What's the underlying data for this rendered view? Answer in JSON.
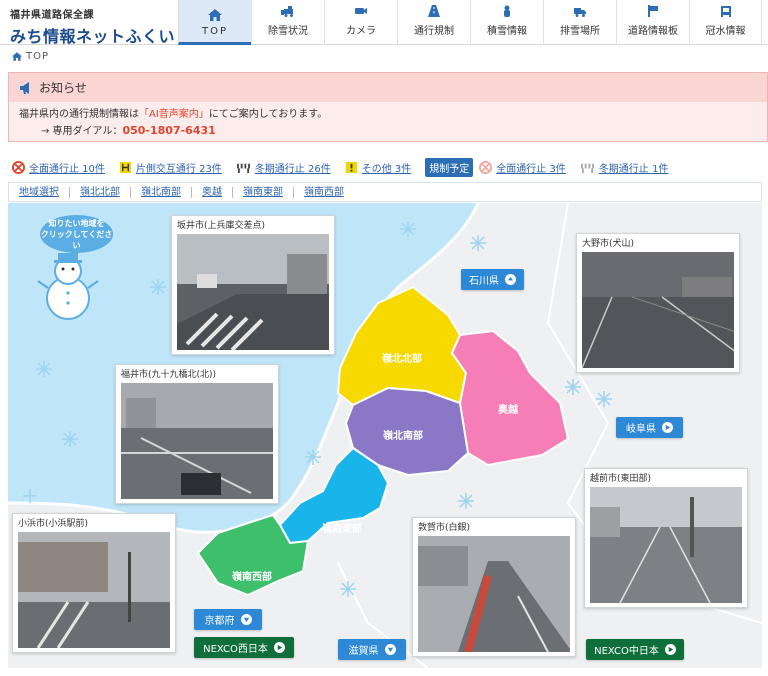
{
  "header": {
    "org": "福井県道路保全課",
    "site_title": "みち情報ネットふくい"
  },
  "nav": [
    {
      "label": "TOP",
      "icon": "home-icon",
      "active": true
    },
    {
      "label": "除雪状況",
      "icon": "snowplow-icon"
    },
    {
      "label": "カメラ",
      "icon": "camera-icon"
    },
    {
      "label": "通行規制",
      "icon": "road-icon"
    },
    {
      "label": "積雪情報",
      "icon": "snow-gauge-icon"
    },
    {
      "label": "排雪場所",
      "icon": "dump-truck-icon"
    },
    {
      "label": "道路情報板",
      "icon": "signboard-icon"
    },
    {
      "label": "冠水情報",
      "icon": "flood-icon"
    }
  ],
  "breadcrumb": {
    "label": "TOP"
  },
  "notice": {
    "title": "お知らせ",
    "line1_pre": "福井県内の通行規制情報は",
    "line1_em": "「AI音声案内」",
    "line1_post": "にてご案内しております。",
    "line2_pre": "→ 専用ダイアル：",
    "phone": "050-1807-6431"
  },
  "status": {
    "full_closure": "全面通行止 10件",
    "alternating": "片側交互通行 23件",
    "winter_closure": "冬期通行止 26件",
    "other": "その他 3件",
    "planned_badge": "規制予定",
    "planned_full": "全面通行止 3件",
    "planned_winter": "冬期通行止 1件"
  },
  "area_tabs": [
    "地域選択",
    "嶺北北部",
    "嶺北南部",
    "奥越",
    "嶺南東部",
    "嶺南西部"
  ],
  "map": {
    "bubble_line1": "知りたい地域を",
    "bubble_line2": "クリックしてください",
    "regions": {
      "reihoku_north": "嶺北北部",
      "reihoku_south": "嶺北南部",
      "okuetsu": "奥越",
      "reinan_east": "嶺南東部",
      "reinan_west": "嶺南西部"
    },
    "cameras": {
      "sakai": "坂井市(上兵庫交差点)",
      "ono": "大野市(犬山)",
      "fukui": "福井市(九十九橋北(北))",
      "echizen": "越前市(東田部)",
      "obama": "小浜市(小浜駅前)",
      "tsuruga": "敦賀市(白銀)"
    },
    "links": {
      "ishikawa": "石川県",
      "gifu": "岐阜県",
      "kyoto": "京都府",
      "shiga": "滋賀県",
      "nexco_west": "NEXCO西日本",
      "nexco_central": "NEXCO中日本"
    }
  },
  "colors": {
    "brand": "#1a4b8c",
    "nav_active": "#dde9f6",
    "notice_bg": "#fbd4d4",
    "alert": "#e0452f",
    "link": "#2f64b1",
    "reihoku_north": "#f7d900",
    "reihoku_south": "#8a78c6",
    "okuetsu": "#f47eb5",
    "reinan_east": "#19b5ea",
    "reinan_west": "#3dbf6c",
    "sea": "#bfe6f8"
  }
}
